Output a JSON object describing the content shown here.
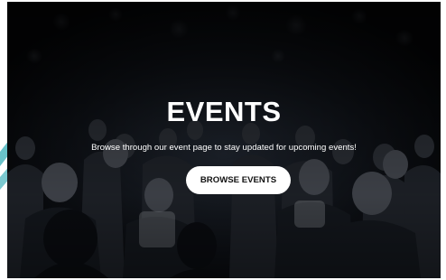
{
  "hero": {
    "title": "EVENTS",
    "subtitle": "Browse through our event page to stay updated for upcoming events!",
    "cta_label": "BROWSE EVENTS",
    "background_image": "audience-seated-at-conference-photo"
  },
  "colors": {
    "overlay": "#07090c",
    "text": "#ffffff",
    "button_bg": "#ffffff",
    "button_text": "#111111",
    "accent_stripe": "#4fb7c0"
  }
}
